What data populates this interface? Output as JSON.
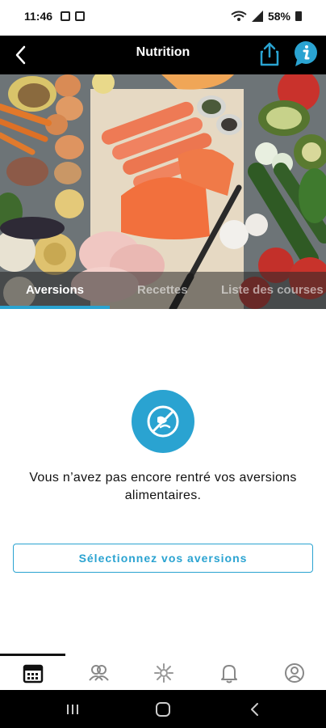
{
  "status_bar": {
    "time": "11:46",
    "battery": "58%"
  },
  "header": {
    "title": "Nutrition"
  },
  "tabs": [
    {
      "label": "Aversions",
      "active": true
    },
    {
      "label": "Recettes",
      "active": false
    },
    {
      "label": "Liste des courses",
      "active": false
    }
  ],
  "empty_state": {
    "message_line1": "Vous n’avez pas encore rentré vos aversions",
    "message_line2": "alimentaires.",
    "button_label": "Sélectionnez vos aversions"
  },
  "colors": {
    "accent": "#2aa3d1",
    "header_bg": "#000000"
  },
  "bottom_nav": {
    "items": [
      "calendar-icon",
      "community-icon",
      "nutrition-icon",
      "bell-icon",
      "profile-icon"
    ],
    "active_index": 0
  }
}
